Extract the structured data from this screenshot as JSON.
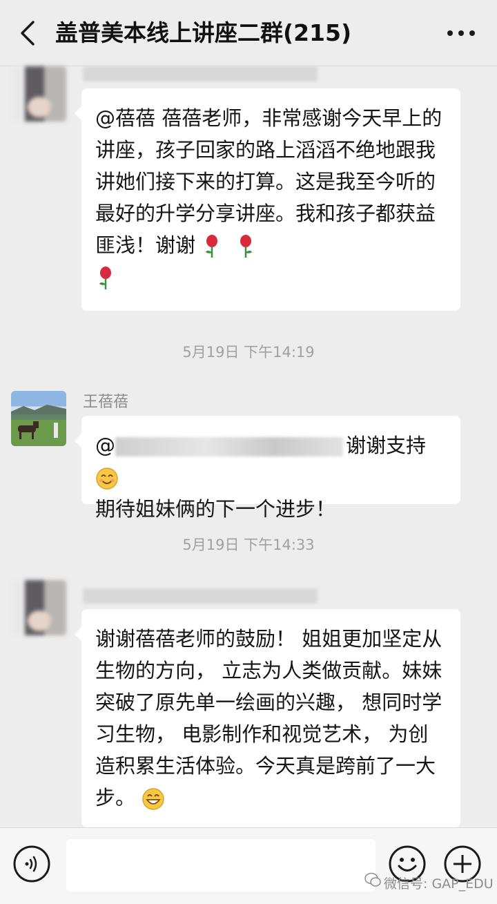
{
  "header": {
    "title": "盖普美本线上讲座二群(215)"
  },
  "messages": [
    {
      "text": "@蓓蓓  蓓蓓老师，非常感谢今天早上的讲座，孩子回家的路上滔滔不绝地跟我讲她们接下来的打算。这是我至今听的最好的升学分享讲座。我和孩子都获益匪浅！谢谢"
    },
    {
      "timestamp": "5月19日 下午14:19"
    },
    {
      "sender": "王蓓蓓",
      "prefix": "@",
      "text": "谢谢支持",
      "text2": "期待姐妹俩的下一个进步！"
    },
    {
      "timestamp": "5月19日 下午14:33"
    },
    {
      "text": "谢谢蓓蓓老师的鼓励！ 姐姐更加坚定从生物的方向， 立志为人类做贡献。妹妹突破了原先单一绘画的兴趣， 想同时学习生物， 电影制作和视觉艺术， 为创造积累生活体验。今天真是跨前了一大步。"
    }
  ],
  "input_bar": {
    "placeholder": ""
  },
  "watermark": {
    "text": "微信号: GAP_EDU"
  },
  "colors": {
    "background": "#ededed",
    "bubble": "#ffffff",
    "timestamp": "#a0a0a0"
  },
  "icons": [
    "back-arrow-icon",
    "more-dots-icon",
    "voice-icon",
    "emoji-icon",
    "plus-icon",
    "rose-icon",
    "smile-icon",
    "grin-icon",
    "wechat-icon"
  ]
}
